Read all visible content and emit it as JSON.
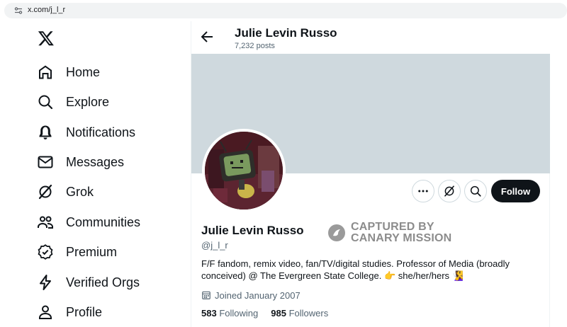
{
  "browser": {
    "url": "x.com/j_l_r",
    "site_settings_icon": "site-settings-icon"
  },
  "nav": {
    "logo_icon": "x-logo-icon",
    "items": [
      {
        "label": "Home",
        "icon": "home-icon"
      },
      {
        "label": "Explore",
        "icon": "search-icon"
      },
      {
        "label": "Notifications",
        "icon": "bell-icon"
      },
      {
        "label": "Messages",
        "icon": "envelope-icon"
      },
      {
        "label": "Grok",
        "icon": "grok-icon"
      },
      {
        "label": "Communities",
        "icon": "people-icon"
      },
      {
        "label": "Premium",
        "icon": "premium-badge-icon"
      },
      {
        "label": "Verified Orgs",
        "icon": "lightning-icon"
      },
      {
        "label": "Profile",
        "icon": "person-icon"
      }
    ]
  },
  "header": {
    "name": "Julie Levin Russo",
    "posts": "7,232 posts",
    "back_icon": "back-arrow-icon"
  },
  "profile": {
    "display_name": "Julie Levin Russo",
    "handle": "@j_l_r",
    "bio_text": "F/F fandom, remix video, fan/TV/digital studies. Professor of Media (broadly conceived) @ The Evergreen State College.",
    "bio_emoji_1": "👉",
    "bio_pronouns": "she/her/hers",
    "bio_emoji_2": "🧏‍♀️",
    "joined": "Joined January 2007",
    "following_count": "583",
    "following_label": "Following",
    "followers_count": "985",
    "followers_label": "Followers",
    "banner_color": "#cfd9de"
  },
  "actions": {
    "more_icon": "more-icon",
    "grok_icon": "grok-icon",
    "search_icon": "search-icon",
    "follow_label": "Follow"
  },
  "watermark": {
    "line1": "CAPTURED BY",
    "line2": "CANARY MISSION"
  }
}
